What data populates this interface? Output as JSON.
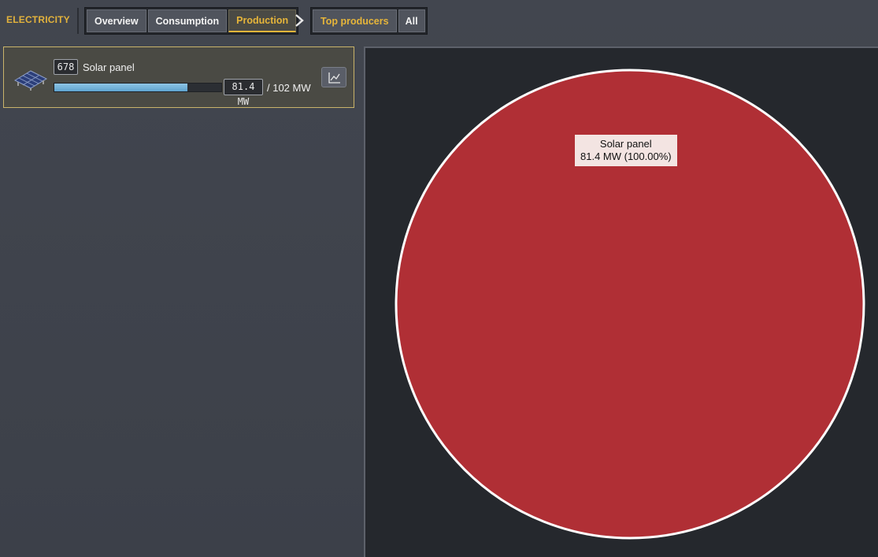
{
  "header": {
    "section_title": "ELECTRICITY",
    "tabs": [
      {
        "label": "Overview"
      },
      {
        "label": "Consumption"
      },
      {
        "label": "Production"
      }
    ],
    "sub_tabs": [
      {
        "label": "Top producers"
      },
      {
        "label": "All"
      }
    ]
  },
  "producers": [
    {
      "icon": "solar-panel-icon",
      "count": "678",
      "name": "Solar panel",
      "output": "81.4 MW",
      "capacity": "/ 102 MW",
      "fill_fraction": 0.798
    }
  ],
  "chart_data": {
    "type": "pie",
    "slices": [
      {
        "label": "Solar panel",
        "value": 81.4,
        "unit": "MW",
        "percent": 100.0,
        "color": "#b02f35"
      }
    ],
    "tooltip": {
      "line1": "Solar panel",
      "line2": "81.4 MW (100.00%)"
    }
  },
  "colors": {
    "accent": "#e2b23c",
    "bar_fill": "#6aaed8",
    "pie_slice": "#b02f35"
  }
}
